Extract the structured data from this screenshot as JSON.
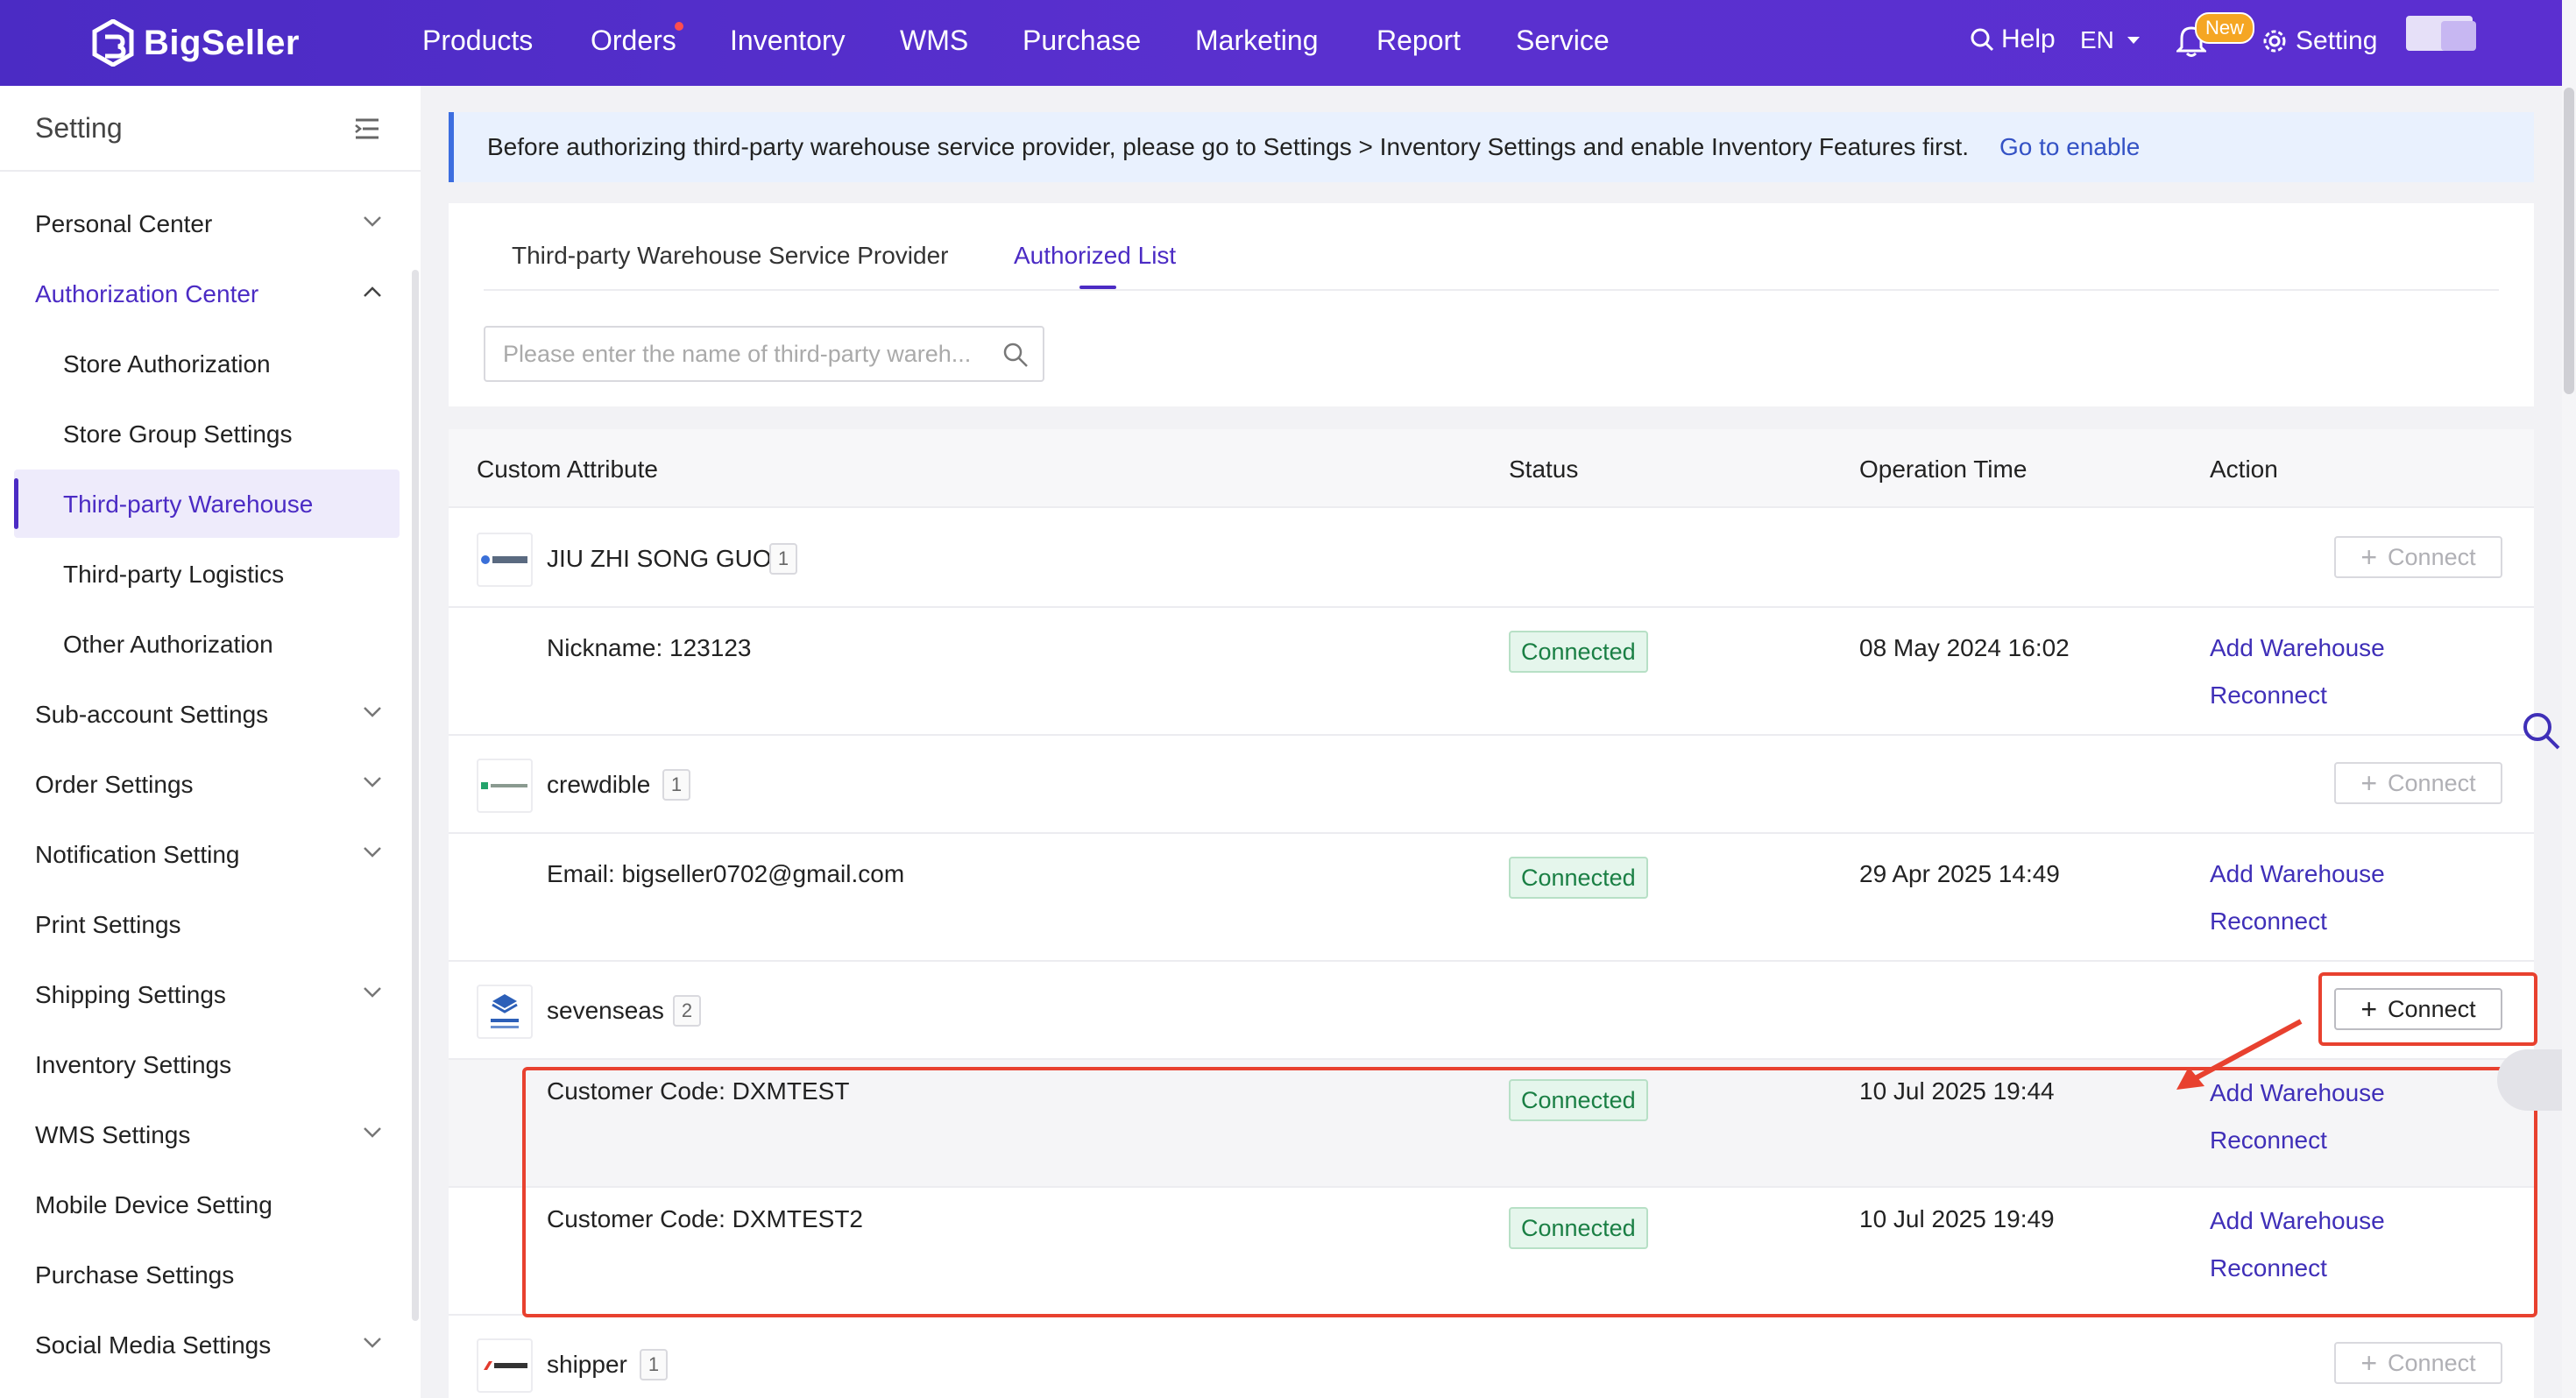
{
  "brand": {
    "name": "BigSeller"
  },
  "topnav": {
    "items": [
      "Products",
      "Orders",
      "Inventory",
      "WMS",
      "Purchase",
      "Marketing",
      "Report",
      "Service"
    ],
    "help": "Help",
    "lang": "EN",
    "new_badge": "New",
    "setting": "Setting"
  },
  "sidebar": {
    "title": "Setting",
    "items": [
      {
        "label": "Personal Center"
      },
      {
        "label": "Authorization Center"
      },
      {
        "label": "Store Authorization"
      },
      {
        "label": "Store Group Settings"
      },
      {
        "label": "Third-party Warehouse"
      },
      {
        "label": "Third-party Logistics"
      },
      {
        "label": "Other Authorization"
      },
      {
        "label": "Sub-account Settings"
      },
      {
        "label": "Order Settings"
      },
      {
        "label": "Notification Setting"
      },
      {
        "label": "Print Settings"
      },
      {
        "label": "Shipping Settings"
      },
      {
        "label": "Inventory Settings"
      },
      {
        "label": "WMS Settings"
      },
      {
        "label": "Mobile Device Setting"
      },
      {
        "label": "Purchase Settings"
      },
      {
        "label": "Social Media Settings"
      }
    ]
  },
  "notice": {
    "text": "Before authorizing third-party warehouse service provider, please go to Settings > Inventory Settings and enable Inventory Features first.",
    "link": "Go to enable"
  },
  "tabs": [
    "Third-party Warehouse Service Provider",
    "Authorized List"
  ],
  "search": {
    "placeholder": "Please enter the name of third-party wareh..."
  },
  "table": {
    "headers": [
      "Custom Attribute",
      "Status",
      "Operation Time",
      "Action"
    ],
    "connect_label": "Connect",
    "groups": [
      {
        "name": "JIU ZHI SONG GUO",
        "count": "1",
        "rows": [
          {
            "attr": "Nickname: 123123",
            "status": "Connected",
            "time": "08 May 2024 16:02",
            "add": "Add Warehouse",
            "reconnect": "Reconnect"
          }
        ]
      },
      {
        "name": "crewdible",
        "count": "1",
        "rows": [
          {
            "attr": "Email: bigseller0702@gmail.com",
            "status": "Connected",
            "time": "29 Apr 2025 14:49",
            "add": "Add Warehouse",
            "reconnect": "Reconnect"
          }
        ]
      },
      {
        "name": "sevenseas",
        "count": "2",
        "rows": [
          {
            "attr": "Customer Code: DXMTEST",
            "status": "Connected",
            "time": "10 Jul 2025 19:44",
            "add": "Add Warehouse",
            "reconnect": "Reconnect"
          },
          {
            "attr": "Customer Code: DXMTEST2",
            "status": "Connected",
            "time": "10 Jul 2025 19:49",
            "add": "Add Warehouse",
            "reconnect": "Reconnect"
          }
        ]
      },
      {
        "name": "shipper",
        "count": "1",
        "rows": []
      }
    ]
  },
  "colors": {
    "brand": "#4b2bc4",
    "highlight": "#e8412f",
    "connected_bg": "#e5f6ec",
    "connected_text": "#1a7f44"
  }
}
